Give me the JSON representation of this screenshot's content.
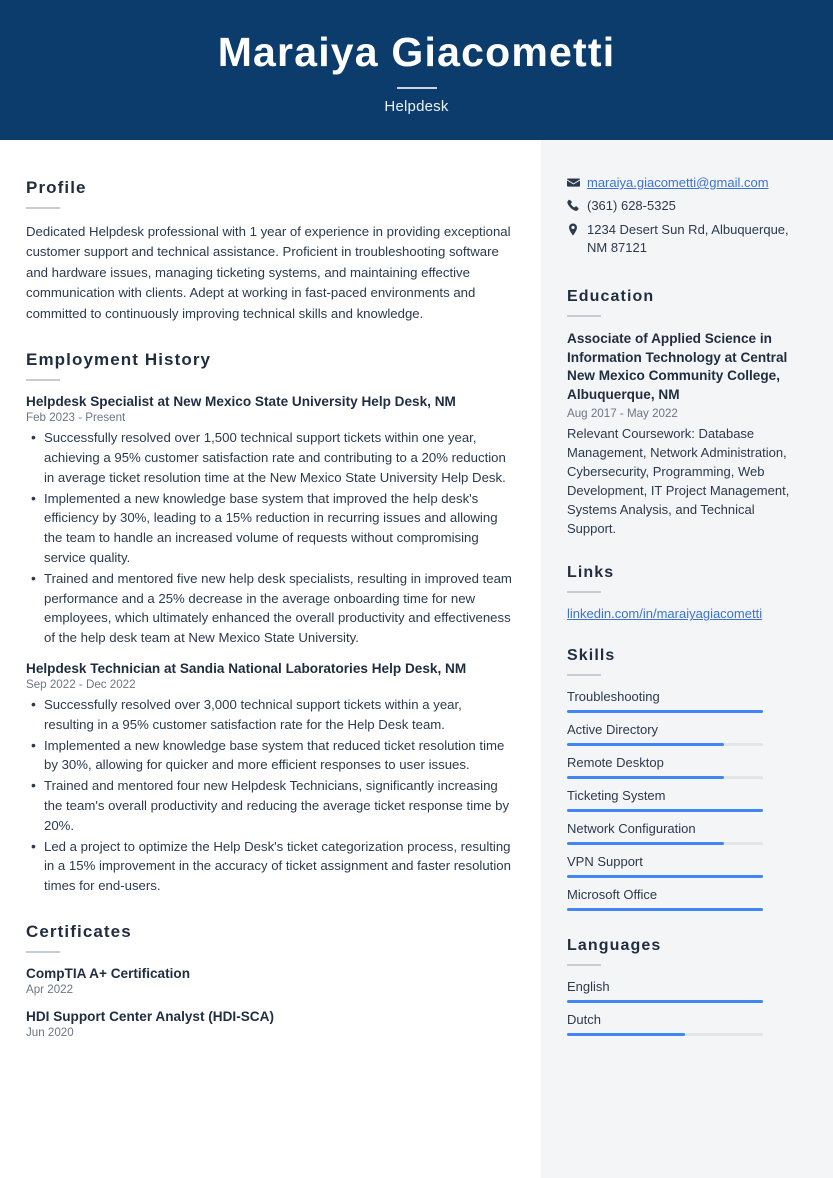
{
  "theme": {
    "header_bg": "#0b3c6b",
    "sidebar_bg": "#f4f5f7",
    "accent_bar": "#4285f4",
    "link_color": "#3b73d4",
    "text_color": "#2b3a4d"
  },
  "header": {
    "name": "Maraiya Giacometti",
    "job_title": "Helpdesk"
  },
  "main": {
    "profile": {
      "heading": "Profile",
      "text": "Dedicated Helpdesk professional with 1 year of experience in providing exceptional customer support and technical assistance. Proficient in troubleshooting software and hardware issues, managing ticketing systems, and maintaining effective communication with clients. Adept at working in fast-paced environments and committed to continuously improving technical skills and knowledge."
    },
    "employment": {
      "heading": "Employment History",
      "jobs": [
        {
          "title": "Helpdesk Specialist at New Mexico State University Help Desk, NM",
          "dates": "Feb 2023 - Present",
          "bullets": [
            "Successfully resolved over 1,500 technical support tickets within one year, achieving a 95% customer satisfaction rate and contributing to a 20% reduction in average ticket resolution time at the New Mexico State University Help Desk.",
            "Implemented a new knowledge base system that improved the help desk's efficiency by 30%, leading to a 15% reduction in recurring issues and allowing the team to handle an increased volume of requests without compromising service quality.",
            "Trained and mentored five new help desk specialists, resulting in improved team performance and a 25% decrease in the average onboarding time for new employees, which ultimately enhanced the overall productivity and effectiveness of the help desk team at New Mexico State University."
          ]
        },
        {
          "title": "Helpdesk Technician at Sandia National Laboratories Help Desk, NM",
          "dates": "Sep 2022 - Dec 2022",
          "bullets": [
            "Successfully resolved over 3,000 technical support tickets within a year, resulting in a 95% customer satisfaction rate for the Help Desk team.",
            "Implemented a new knowledge base system that reduced ticket resolution time by 30%, allowing for quicker and more efficient responses to user issues.",
            "Trained and mentored four new Helpdesk Technicians, significantly increasing the team's overall productivity and reducing the average ticket response time by 20%.",
            "Led a project to optimize the Help Desk's ticket categorization process, resulting in a 15% improvement in the accuracy of ticket assignment and faster resolution times for end-users."
          ]
        }
      ]
    },
    "certificates": {
      "heading": "Certificates",
      "items": [
        {
          "title": "CompTIA A+ Certification",
          "date": "Apr 2022"
        },
        {
          "title": "HDI Support Center Analyst (HDI-SCA)",
          "date": "Jun 2020"
        }
      ]
    }
  },
  "sidebar": {
    "contact": [
      {
        "icon": "envelope-icon",
        "text": "maraiya.giacometti@gmail.com",
        "is_link": true
      },
      {
        "icon": "phone-icon",
        "text": "(361) 628-5325",
        "is_link": false
      },
      {
        "icon": "location-pin-icon",
        "text": "1234 Desert Sun Rd, Albuquerque, NM 87121",
        "is_link": false
      }
    ],
    "education": {
      "heading": "Education",
      "title": "Associate of Applied Science in Information Technology at Central New Mexico Community College, Albuquerque, NM",
      "dates": "Aug 2017 - May 2022",
      "description": "Relevant Coursework: Database Management, Network Administration, Cybersecurity, Programming, Web Development, IT Project Management, Systems Analysis, and Technical Support."
    },
    "links": {
      "heading": "Links",
      "items": [
        {
          "label": "linkedin.com/in/maraiyagiacometti"
        }
      ]
    },
    "skills": {
      "heading": "Skills",
      "items": [
        {
          "label": "Troubleshooting",
          "level": 100
        },
        {
          "label": "Active Directory",
          "level": 80
        },
        {
          "label": "Remote Desktop",
          "level": 80
        },
        {
          "label": "Ticketing System",
          "level": 100
        },
        {
          "label": "Network Configuration",
          "level": 80
        },
        {
          "label": "VPN Support",
          "level": 100
        },
        {
          "label": "Microsoft Office",
          "level": 100
        }
      ]
    },
    "languages": {
      "heading": "Languages",
      "items": [
        {
          "label": "English",
          "level": 100
        },
        {
          "label": "Dutch",
          "level": 60
        }
      ]
    }
  }
}
